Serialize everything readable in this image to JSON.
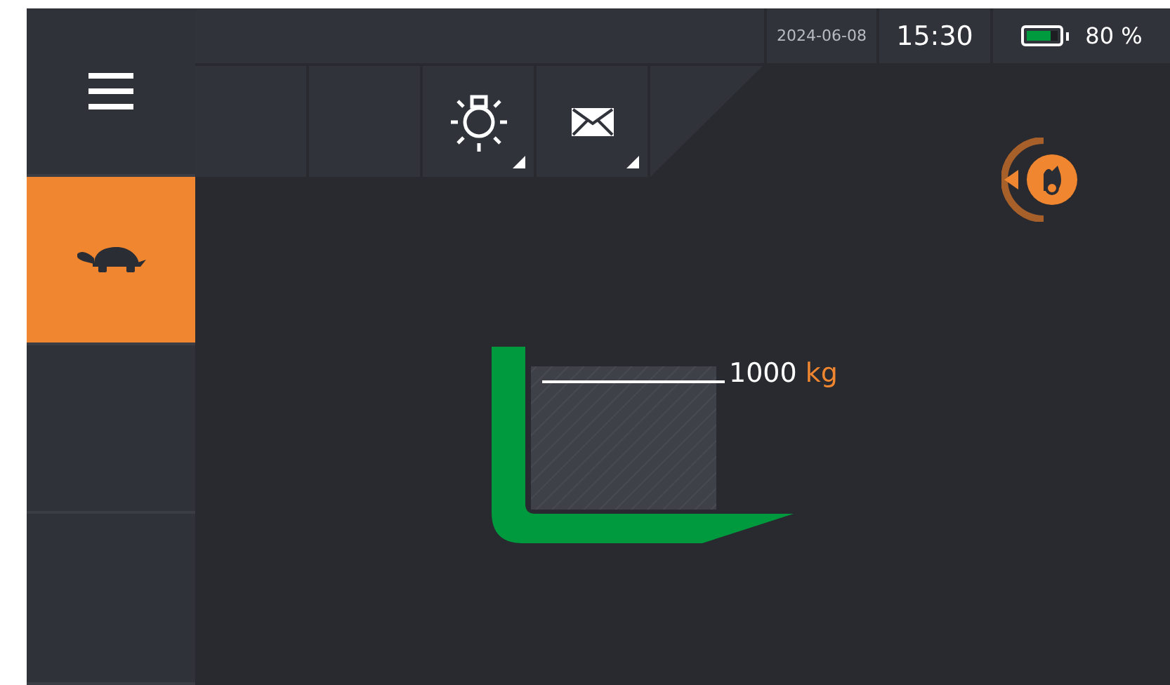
{
  "sidebar": {
    "items": [
      {
        "kind": "menu",
        "selected": false
      },
      {
        "kind": "turtle",
        "selected": true
      },
      {
        "kind": "empty",
        "selected": false
      },
      {
        "kind": "empty",
        "selected": false
      }
    ]
  },
  "status_bar": {
    "date": "2024-06-08",
    "time": "15:30",
    "battery": {
      "level": 0.8,
      "reading": "80 %"
    }
  },
  "toolbar": [
    {
      "kind": "empty",
      "has_menu": false
    },
    {
      "kind": "empty",
      "has_menu": false
    },
    {
      "kind": "light",
      "has_menu": true
    },
    {
      "kind": "mail",
      "has_menu": true
    }
  ],
  "load": {
    "weight": "1000",
    "unit": "kg"
  }
}
